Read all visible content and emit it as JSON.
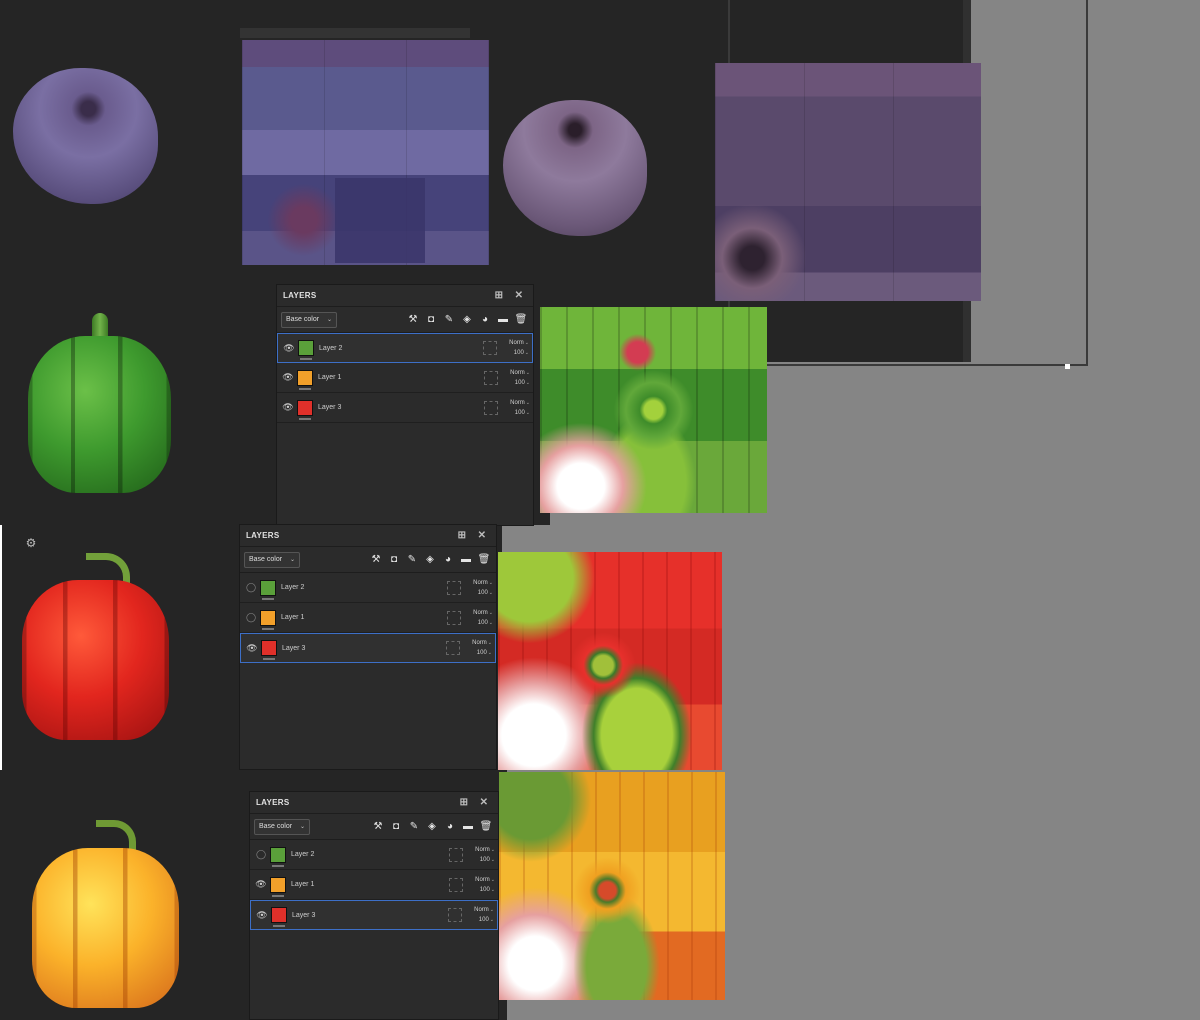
{
  "colors": {
    "panel_bg": "#2b2b2b",
    "selection": "#3d6fc7",
    "workspace": "#858585",
    "viewport": "#252525"
  },
  "panels": [
    {
      "title": "LAYERS",
      "channel": "Base color",
      "layers": [
        {
          "name": "Layer 2",
          "blend": "Norm",
          "opacity": "100",
          "visible": true,
          "selected": true,
          "thumb": "green"
        },
        {
          "name": "Layer 1",
          "blend": "Norm",
          "opacity": "100",
          "visible": true,
          "selected": false,
          "thumb": "orange"
        },
        {
          "name": "Layer 3",
          "blend": "Norm",
          "opacity": "100",
          "visible": true,
          "selected": false,
          "thumb": "red"
        }
      ]
    },
    {
      "title": "LAYERS",
      "channel": "Base color",
      "layers": [
        {
          "name": "Layer 2",
          "blend": "Norm",
          "opacity": "100",
          "visible": false,
          "selected": false,
          "thumb": "green"
        },
        {
          "name": "Layer 1",
          "blend": "Norm",
          "opacity": "100",
          "visible": false,
          "selected": false,
          "thumb": "orange"
        },
        {
          "name": "Layer 3",
          "blend": "Norm",
          "opacity": "100",
          "visible": true,
          "selected": true,
          "thumb": "red"
        }
      ]
    },
    {
      "title": "LAYERS",
      "channel": "Base color",
      "layers": [
        {
          "name": "Layer 2",
          "blend": "Norm",
          "opacity": "100",
          "visible": false,
          "selected": false,
          "thumb": "green"
        },
        {
          "name": "Layer 1",
          "blend": "Norm",
          "opacity": "100",
          "visible": true,
          "selected": false,
          "thumb": "orange"
        },
        {
          "name": "Layer 3",
          "blend": "Norm",
          "opacity": "100",
          "visible": true,
          "selected": true,
          "thumb": "red"
        }
      ]
    }
  ],
  "icons": {
    "eye": "eye-icon",
    "wand": "magic-wand-icon",
    "mask": "add-mask-icon",
    "brush": "brush-icon",
    "fill": "fill-bucket-icon",
    "effects": "effects-icon",
    "folder": "folder-icon",
    "trash": "trash-icon",
    "expand": "expand-icon",
    "close": "close-icon",
    "settings": "settings-icon"
  }
}
